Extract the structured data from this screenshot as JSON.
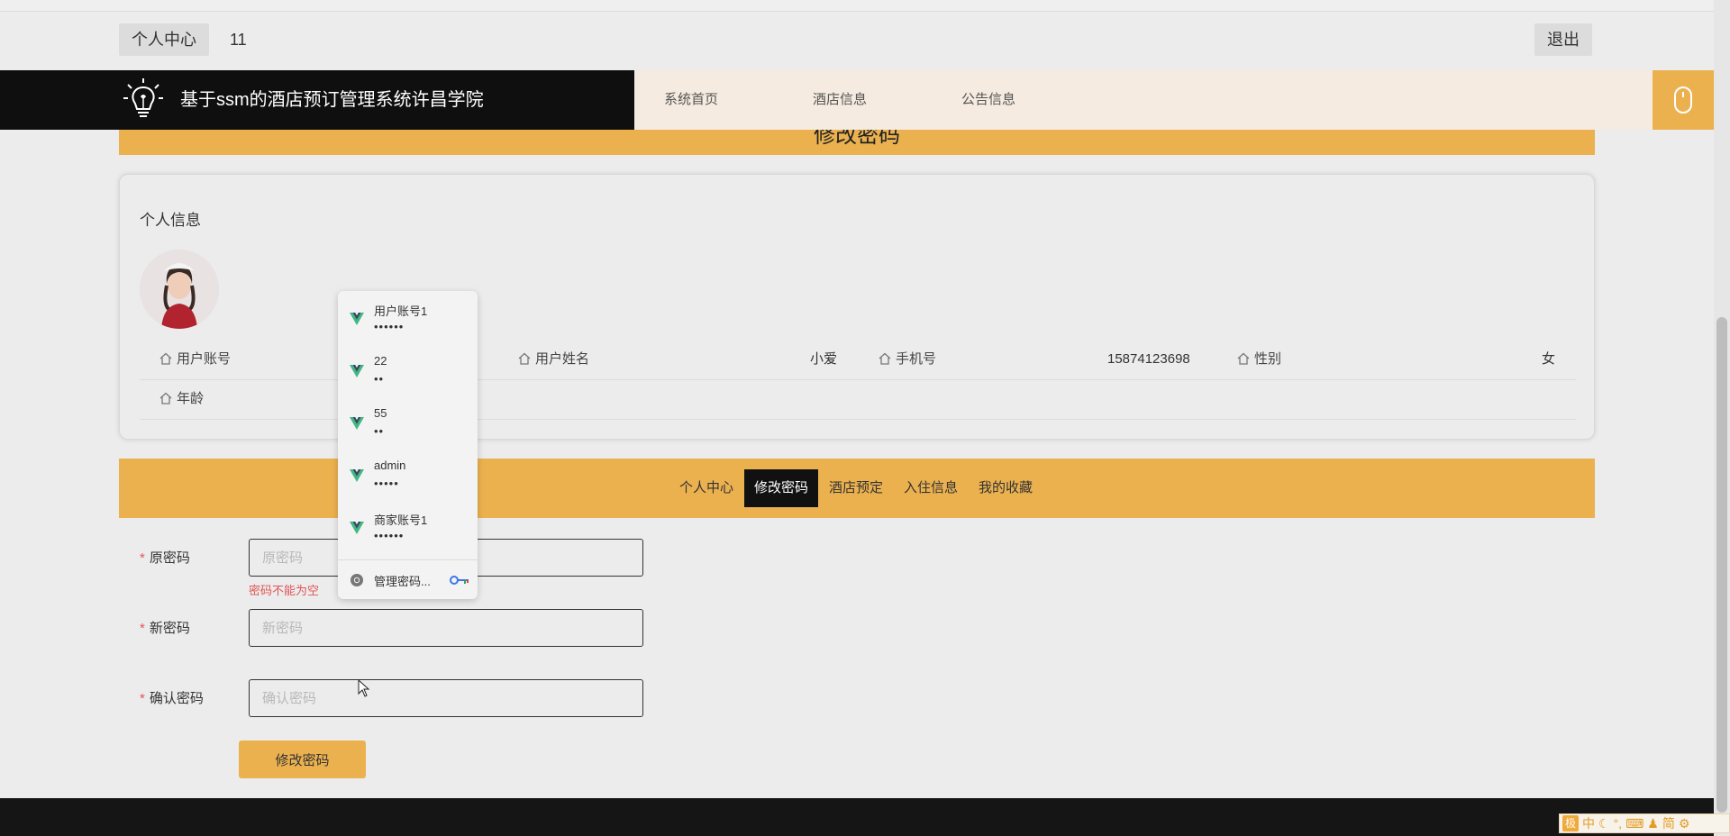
{
  "topbar": {
    "profile_label": "个人中心",
    "username": "11",
    "logout_label": "退出"
  },
  "header": {
    "site_title": "基于ssm的酒店预订管理系统许昌学院",
    "nav": [
      "系统首页",
      "酒店信息",
      "公告信息"
    ]
  },
  "page_title": "修改密码",
  "profile": {
    "title": "个人信息",
    "fields": [
      {
        "label": "用户账号",
        "value": ""
      },
      {
        "label": "用户姓名",
        "value": "小爱"
      },
      {
        "label": "手机号",
        "value": "15874123698"
      },
      {
        "label": "性别",
        "value": "女"
      },
      {
        "label": "年龄",
        "value": ""
      }
    ]
  },
  "tabs": [
    "个人中心",
    "修改密码",
    "酒店预定",
    "入住信息",
    "我的收藏"
  ],
  "active_tab": "修改密码",
  "form": {
    "old_password": {
      "label": "原密码",
      "placeholder": "原密码",
      "error": "密码不能为空"
    },
    "new_password": {
      "label": "新密码",
      "placeholder": "新密码"
    },
    "confirm_password": {
      "label": "确认密码",
      "placeholder": "确认密码"
    },
    "submit_label": "修改密码"
  },
  "autocomplete": {
    "items": [
      {
        "user": "用户账号1",
        "pass": "••••••"
      },
      {
        "user": "22",
        "pass": "••"
      },
      {
        "user": "55",
        "pass": "••"
      },
      {
        "user": "admin",
        "pass": "•••••"
      },
      {
        "user": "商家账号1",
        "pass": "••••••"
      }
    ],
    "manage_label": "管理密码..."
  },
  "ime": {
    "logo": "极",
    "mode": "中",
    "script": "简"
  },
  "colors": {
    "accent": "#ebb14f",
    "dark": "#0f0f0f",
    "error": "#e05555"
  }
}
